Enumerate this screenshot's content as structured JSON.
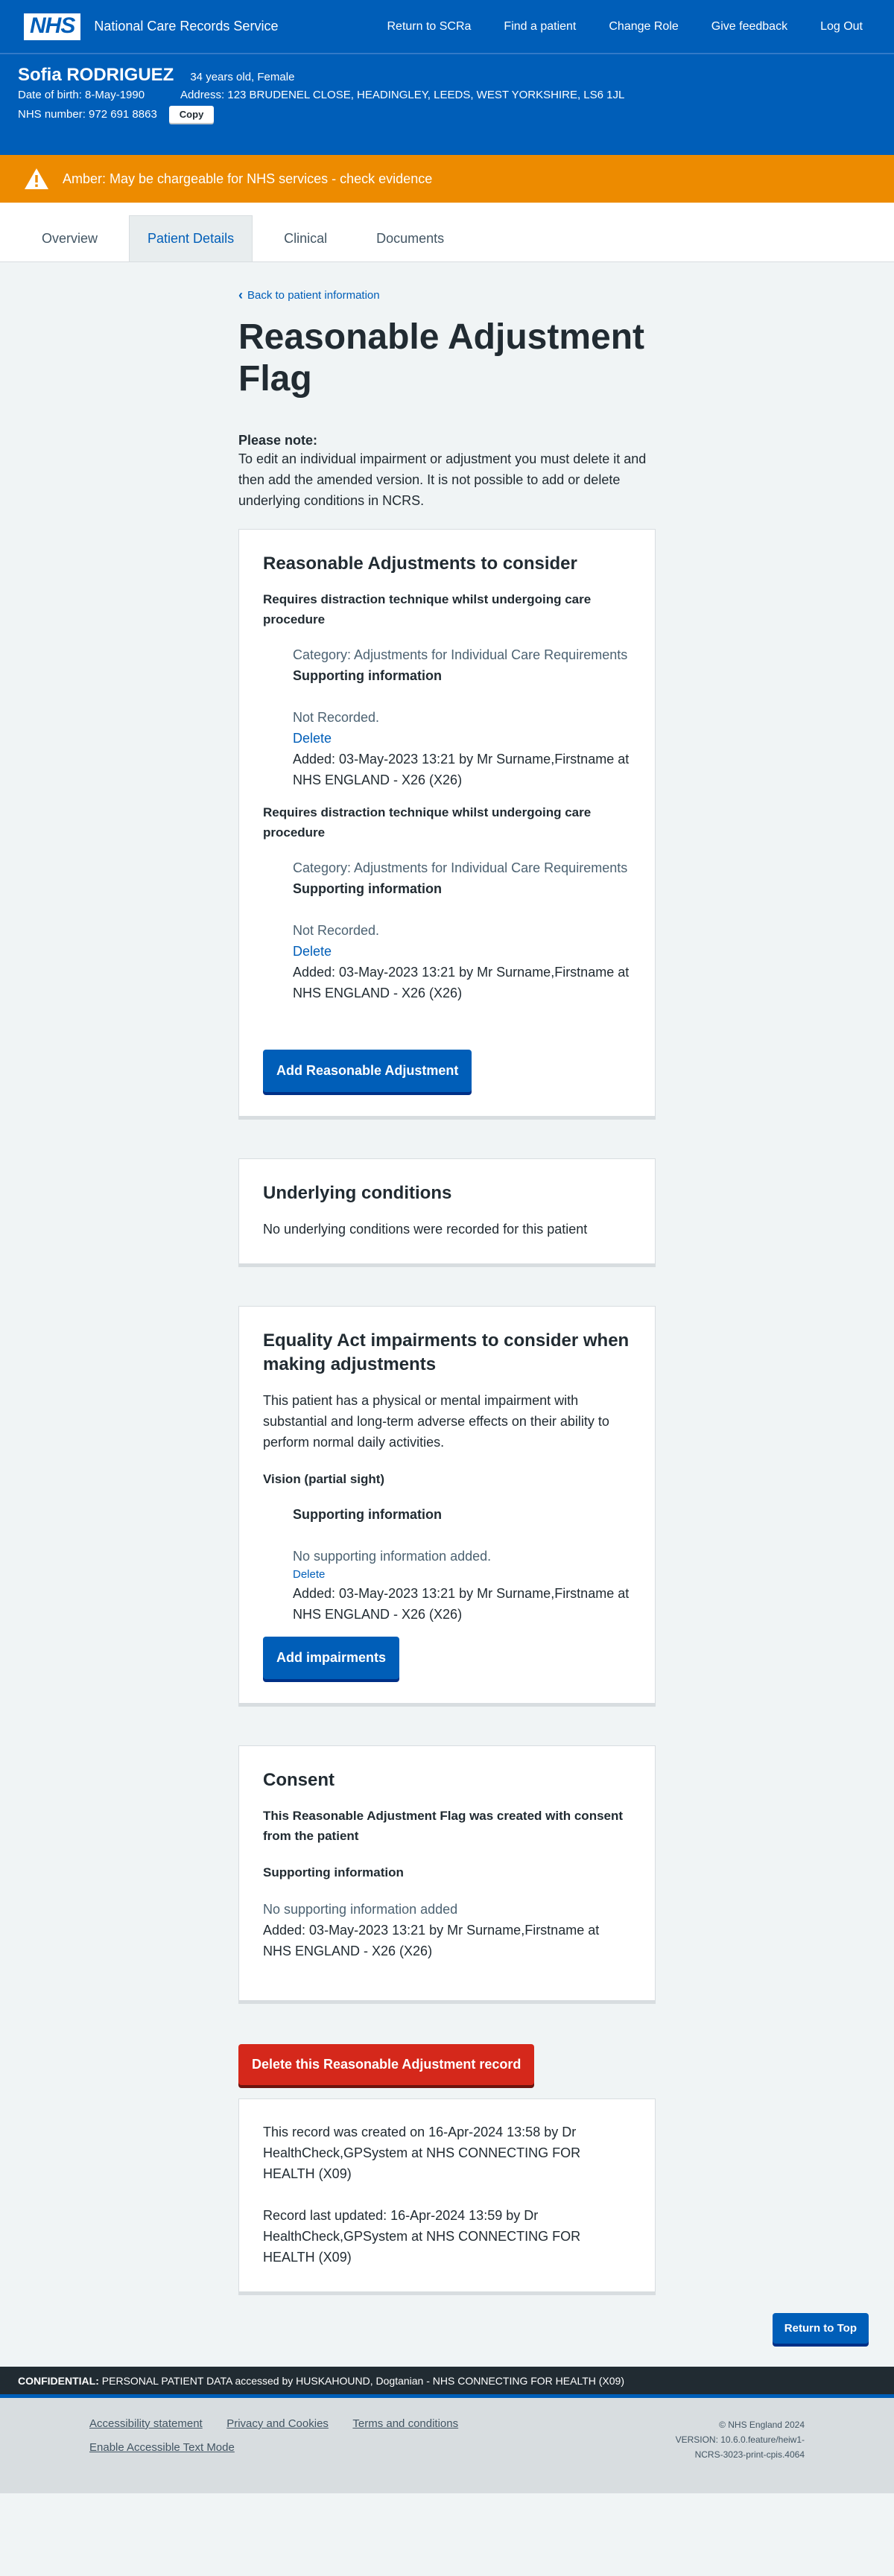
{
  "header": {
    "logo": "NHS",
    "service_name": "National Care Records Service",
    "nav": [
      "Return to SCRa",
      "Find a patient",
      "Change Role",
      "Give feedback",
      "Log Out"
    ]
  },
  "patient": {
    "name": "Sofia RODRIGUEZ",
    "age_sex": "34 years old, Female",
    "dob": "Date of birth: 8-May-1990",
    "address": "Address: 123 BRUDENEL CLOSE, HEADINGLEY, LEEDS, WEST YORKSHIRE, LS6 1JL",
    "nhs_number": "NHS number: 972 691 8863",
    "copy_label": "Copy"
  },
  "alert": {
    "text": "Amber: May be chargeable for NHS services - check evidence",
    "color": "#ed8b00"
  },
  "tabs": [
    "Overview",
    "Patient Details",
    "Clinical",
    "Documents"
  ],
  "active_tab": "Patient Details",
  "page": {
    "back_link": "Back to patient information",
    "title": "Reasonable Adjustment Flag",
    "note_title": "Please note:",
    "note_text": "To edit an individual impairment or adjustment you must delete it and then add the amended version. It is not possible to add or delete underlying conditions in NCRS."
  },
  "adjustments": {
    "heading": "Reasonable Adjustments to consider",
    "items": [
      {
        "title": "Requires distraction technique whilst undergoing care procedure",
        "category": "Category: Adjustments for Individual Care Requirements",
        "supporting_label": "Supporting information",
        "supporting_value": "Not Recorded.",
        "delete_label": "Delete",
        "added": "Added: 03-May-2023 13:21 by Mr Surname,Firstname at NHS ENGLAND - X26 (X26)"
      },
      {
        "title": "Requires distraction technique whilst undergoing care procedure",
        "category": "Category: Adjustments for Individual Care Requirements",
        "supporting_label": "Supporting information",
        "supporting_value": "Not Recorded.",
        "delete_label": "Delete",
        "added": "Added: 03-May-2023 13:21 by Mr Surname,Firstname at NHS ENGLAND - X26 (X26)"
      }
    ],
    "add_button": "Add Reasonable Adjustment"
  },
  "underlying": {
    "heading": "Underlying conditions",
    "text": "No underlying conditions were recorded for this patient"
  },
  "impairments": {
    "heading": "Equality Act impairments to consider when making adjustments",
    "intro": "This patient has a physical or mental impairment with substantial and long-term adverse effects on their ability to perform normal daily activities.",
    "item_title": "Vision (partial sight)",
    "supporting_label": "Supporting information",
    "supporting_value": "No supporting information added.",
    "delete_label": "Delete",
    "added": "Added: 03-May-2023 13:21 by Mr Surname,Firstname at NHS ENGLAND - X26 (X26)",
    "add_button": "Add impairments"
  },
  "consent": {
    "heading": "Consent",
    "statement": "This Reasonable Adjustment Flag was created with consent from the patient",
    "supporting_label": "Supporting information",
    "supporting_value": "No supporting information added",
    "added": "Added: 03-May-2023 13:21 by Mr Surname,Firstname at NHS ENGLAND - X26 (X26)"
  },
  "delete_record_button": "Delete this Reasonable Adjustment record",
  "record_info": {
    "created": "This record was created on 16-Apr-2024 13:58 by Dr HealthCheck,GPSystem at NHS CONNECTING FOR HEALTH (X09)",
    "updated": "Record last updated: 16-Apr-2024 13:59 by Dr HealthCheck,GPSystem at NHS CONNECTING FOR HEALTH (X09)"
  },
  "return_to_top": "Return to Top",
  "confidential": {
    "label": "CONFIDENTIAL:",
    "text": " PERSONAL PATIENT DATA accessed by HUSKAHOUND, Dogtanian - NHS CONNECTING FOR HEALTH (X09)"
  },
  "footer": {
    "links": [
      "Accessibility statement",
      "Privacy and Cookies",
      "Terms and conditions",
      "Enable Accessible Text Mode"
    ],
    "copyright": "© NHS England 2024",
    "version_line1": "VERSION: 10.6.0.feature/heiw1-",
    "version_line2": "NCRS-3023-print-cpis.4064"
  }
}
